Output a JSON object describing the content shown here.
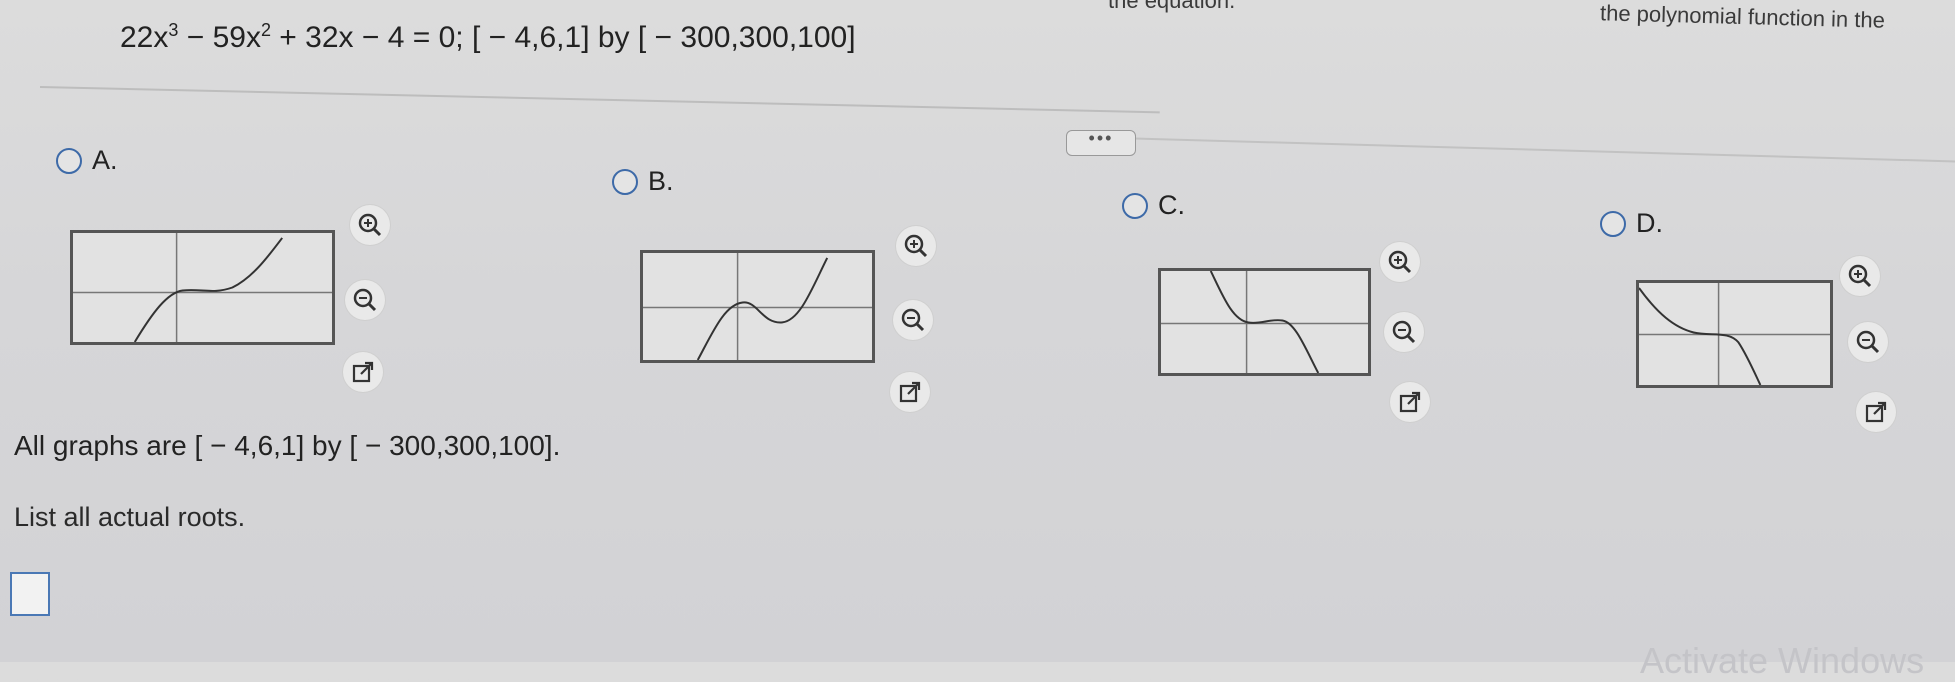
{
  "header": {
    "fragment_middle": "the equation.",
    "fragment_right": "the polynomial function in the"
  },
  "question": {
    "equation_parts": [
      "22x",
      "3",
      " − 59x",
      "2",
      " + 32x − 4 = 0; [ − 4,6,1] by [ − 300,300,100]"
    ],
    "more_button": "•••"
  },
  "options": [
    {
      "letter": "A.",
      "selected": false
    },
    {
      "letter": "B.",
      "selected": false
    },
    {
      "letter": "C.",
      "selected": false
    },
    {
      "letter": "D.",
      "selected": false
    }
  ],
  "graph_window": {
    "xmin": -4,
    "xmax": 6,
    "xscl": 1,
    "ymin": -300,
    "ymax": 300,
    "yscl": 100
  },
  "icons": [
    "zoom-in-icon",
    "zoom-out-icon",
    "open-external-icon"
  ],
  "note": "All graphs are [ − 4,6,1] by [ − 300,300,100].",
  "prompt": "List all actual roots.",
  "answer": {
    "value": ""
  },
  "watermark": "Activate Windows",
  "colors": {
    "radio": "#3d6aa8",
    "answer_border": "#4a78b5"
  }
}
